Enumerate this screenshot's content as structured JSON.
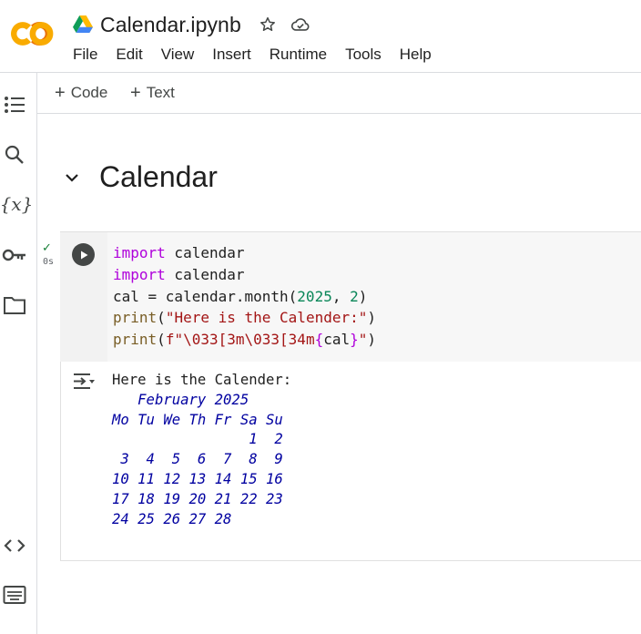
{
  "app": {
    "logo_text": "CO",
    "notebook_title": "Calendar.ipynb"
  },
  "menu": [
    "File",
    "Edit",
    "View",
    "Insert",
    "Runtime",
    "Tools",
    "Help"
  ],
  "toolbar": {
    "add_code_label": "Code",
    "add_text_label": "Text"
  },
  "section": {
    "title": "Calendar"
  },
  "cell": {
    "status_check": "✓",
    "exec_time": "0s",
    "code": {
      "line1_kw": "import",
      "line1_rest": " calendar",
      "line2_kw": "import",
      "line2_rest": " calendar",
      "line3_a": "cal = calendar.month(",
      "line3_num1": "2025",
      "line3_b": ", ",
      "line3_num2": "2",
      "line3_c": ")",
      "line4_fn": "print",
      "line4_a": "(",
      "line4_str": "\"Here is the Calender:\"",
      "line4_b": ")",
      "line5_fn": "print",
      "line5_a": "(",
      "line5_str1": "f\"\\033[3m\\033[34m",
      "line5_brace1": "{",
      "line5_var": "cal",
      "line5_brace2": "}",
      "line5_str2": "\"",
      "line5_b": ")"
    },
    "output": {
      "line1": "Here is the Calender:",
      "calendar_lines": [
        "   February 2025",
        "Mo Tu We Th Fr Sa Su",
        "                1  2",
        " 3  4  5  6  7  8  9",
        "10 11 12 13 14 15 16",
        "17 18 19 20 21 22 23",
        "24 25 26 27 28"
      ]
    }
  },
  "colors": {
    "accent_orange": "#f9ab00",
    "logo_orange_dark": "#e8710a",
    "keyword": "#af00db",
    "string": "#a31515",
    "number": "#098658",
    "calendar_output": "#0000a0",
    "success_check": "#188038"
  },
  "icons": {
    "sidebar": [
      "table-of-contents-icon",
      "search-icon",
      "variables-icon",
      "secrets-key-icon",
      "files-folder-icon",
      "code-snippets-icon",
      "command-palette-icon"
    ],
    "header": [
      "google-drive-icon",
      "star-icon",
      "cloud-saved-icon"
    ]
  }
}
